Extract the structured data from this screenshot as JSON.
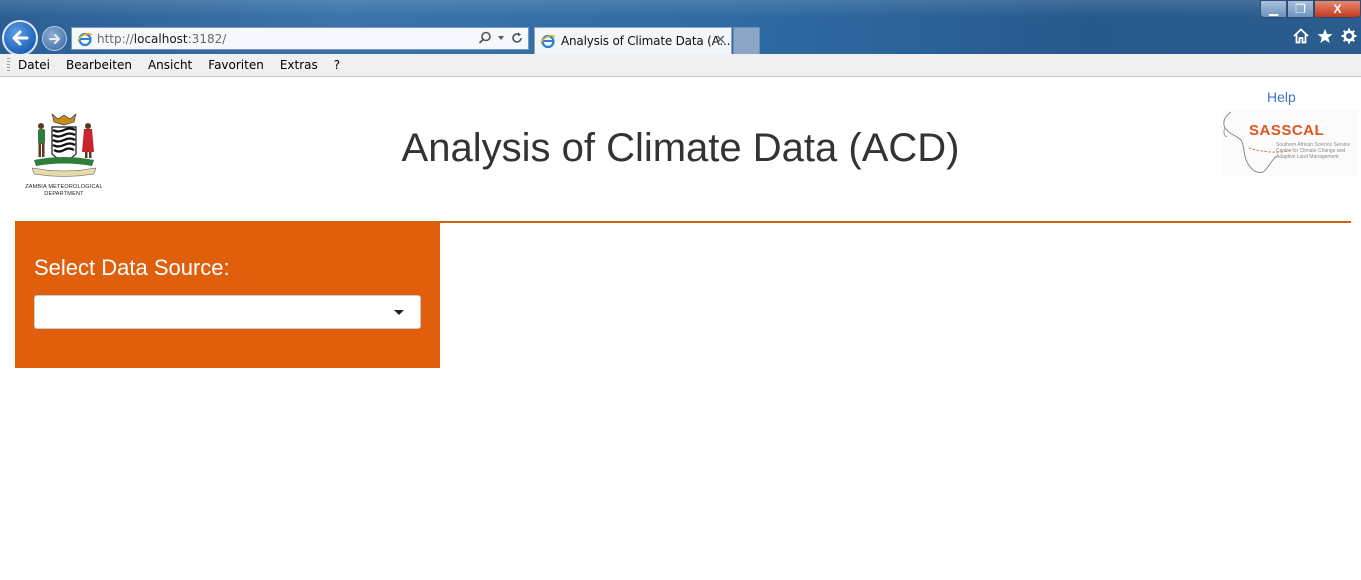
{
  "browser": {
    "address": {
      "protocol": "http://",
      "host": "localhost",
      "rest": ":3182/"
    },
    "tab": {
      "title": "Analysis of Climate Data (A...",
      "close": "✕"
    },
    "window_controls": {
      "minimize": "▁",
      "maximize": "❐",
      "close": "X"
    },
    "toolbar_icons": [
      "home-icon",
      "star-icon",
      "gear-icon"
    ],
    "menu": [
      "Datei",
      "Bearbeiten",
      "Ansicht",
      "Favoriten",
      "Extras",
      "?"
    ]
  },
  "page": {
    "title": "Analysis of Climate Data (ACD)",
    "help_link": "Help",
    "left_logo_caption": "ZAMBIA METEOROLOGICAL DEPARTMENT",
    "right_logo": {
      "name": "SASSCAL",
      "subtitle": "Southern African Science Service Centre for Climate Change and Adaptive Land Management"
    },
    "sidebar": {
      "label": "Select Data Source:",
      "select_value": ""
    }
  },
  "colors": {
    "accent": "#df5f0c",
    "help_link": "#3d74c2",
    "title": "#333333"
  }
}
